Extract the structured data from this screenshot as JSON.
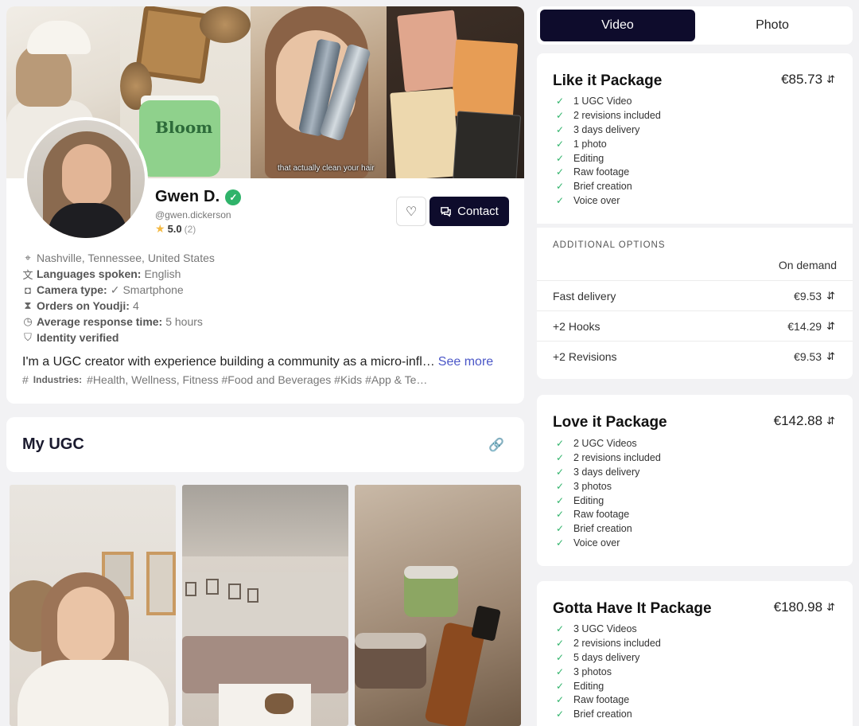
{
  "profile": {
    "name": "Gwen D.",
    "handle": "@gwen.dickerson",
    "rating": "5.0",
    "rating_count": "(2)",
    "location": "Nashville, Tennessee, United States",
    "languages_label": "Languages spoken:",
    "languages_value": "English",
    "camera_label": "Camera type:",
    "camera_value": "Smartphone",
    "orders_label": "Orders on Youdji:",
    "orders_value": "4",
    "response_label": "Average response time:",
    "response_value": "5 hours",
    "identity": "Identity verified",
    "bio": "I'm a UGC creator with experience building a community as a micro-infl…",
    "see_more": "See more",
    "industries_label": "Industries:",
    "industries": "#Health, Wellness, Fitness #Food and Beverages #Kids #App & Te…",
    "contact_label": "Contact",
    "banner_caption": "that actually clean your hair",
    "banner_brand": "Bloom",
    "accent_color": "#0e0c2c",
    "verified_color": "#2fb36a"
  },
  "ugc": {
    "title": "My UGC"
  },
  "toggle": {
    "video": "Video",
    "photo": "Photo",
    "selected": "Video"
  },
  "packages": [
    {
      "title": "Like it Package",
      "price": "€85.73",
      "features": [
        "1 UGC Video",
        "2 revisions included",
        "3 days delivery",
        "1 photo",
        "Editing",
        "Raw footage",
        "Brief creation",
        "Voice over"
      ]
    },
    {
      "title": "Love it Package",
      "price": "€142.88",
      "features": [
        "2 UGC Videos",
        "2 revisions included",
        "3 days delivery",
        "3 photos",
        "Editing",
        "Raw footage",
        "Brief creation",
        "Voice over"
      ]
    },
    {
      "title": "Gotta Have It Package",
      "price": "€180.98",
      "features": [
        "3 UGC Videos",
        "2 revisions included",
        "5 days delivery",
        "3 photos",
        "Editing",
        "Raw footage",
        "Brief creation"
      ]
    }
  ],
  "additional": {
    "heading": "ADDITIONAL OPTIONS",
    "on_demand": "On demand",
    "options": [
      {
        "label": "Fast delivery",
        "price": "€9.53"
      },
      {
        "label": "+2 Hooks",
        "price": "€14.29"
      },
      {
        "label": "+2 Revisions",
        "price": "€9.53"
      }
    ]
  }
}
